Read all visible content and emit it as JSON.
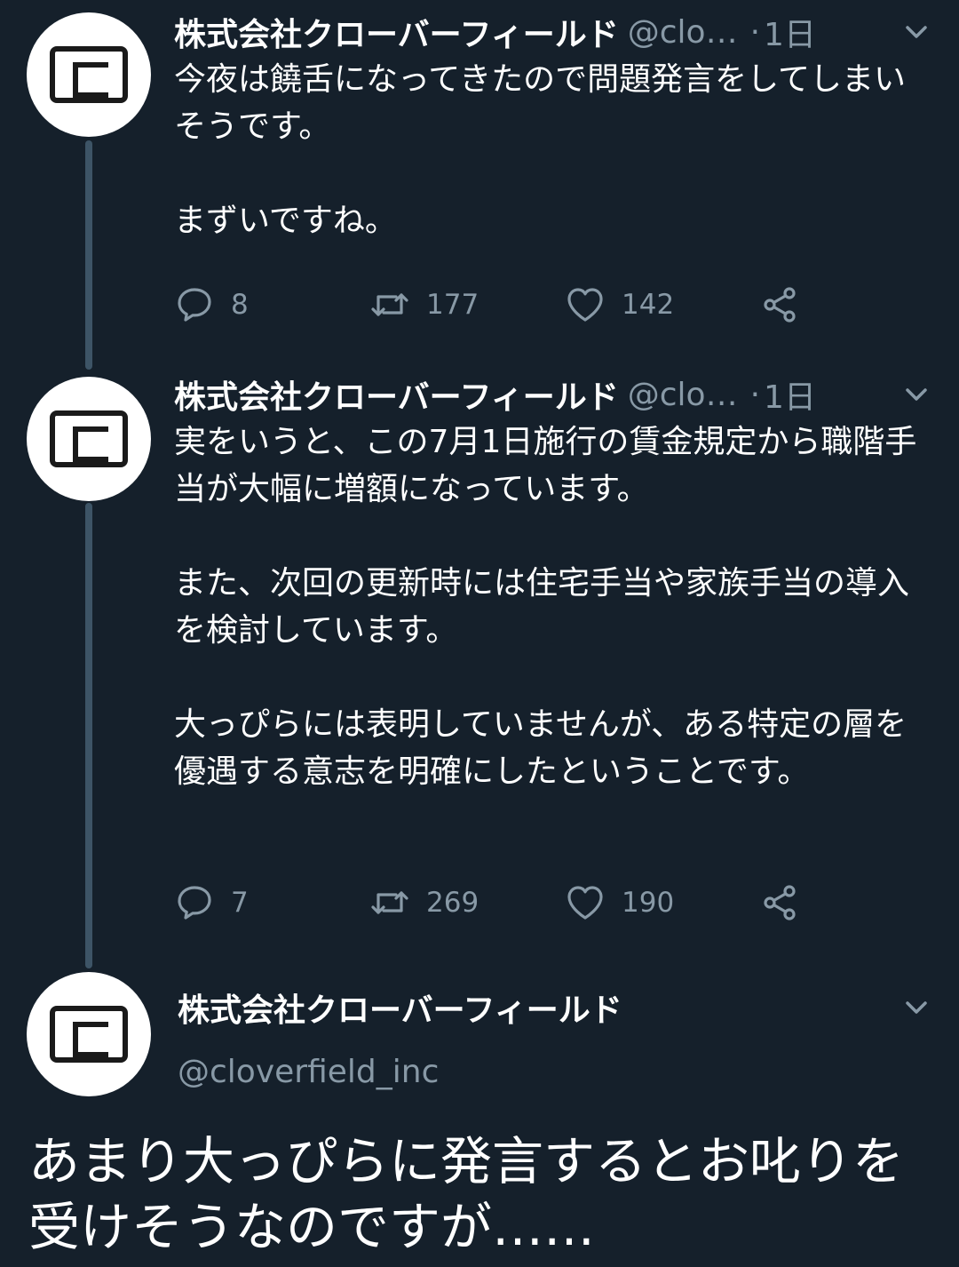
{
  "tweets": [
    {
      "name": "株式会社クローバーフィールド",
      "handle": "@clo…",
      "dot": "·",
      "time": "1日",
      "body": [
        "今夜は饒舌になってきたので問題発言をしてしまいそうです。",
        "",
        "まずいですね。"
      ],
      "replies": "8",
      "retweets": "177",
      "likes": "142"
    },
    {
      "name": "株式会社クローバーフィールド",
      "handle": "@clo…",
      "dot": "·",
      "time": "1日",
      "body": [
        "実をいうと、この7月1日施行の賃金規定から職階手当が大幅に増額になっています。",
        "",
        "また、次回の更新時には住宅手当や家族手当の導入を検討しています。",
        "",
        "大っぴらには表明していませんが、ある特定の層を優遇する意志を明確にしたということです。"
      ],
      "replies": "7",
      "retweets": "269",
      "likes": "190"
    }
  ],
  "main_tweet": {
    "name": "株式会社クローバーフィールド",
    "handle": "@cloverfield_inc",
    "text": "あまり大っぴらに発言するとお叱りを受けそうなのですが……"
  },
  "icons": {
    "reply": "reply-icon",
    "retweet": "retweet-icon",
    "like": "heart-icon",
    "share": "share-icon",
    "menu": "chevron-down-icon"
  },
  "colors": {
    "background": "#15202b",
    "secondary_text": "#8899a6",
    "thread_line": "#3d5466"
  }
}
